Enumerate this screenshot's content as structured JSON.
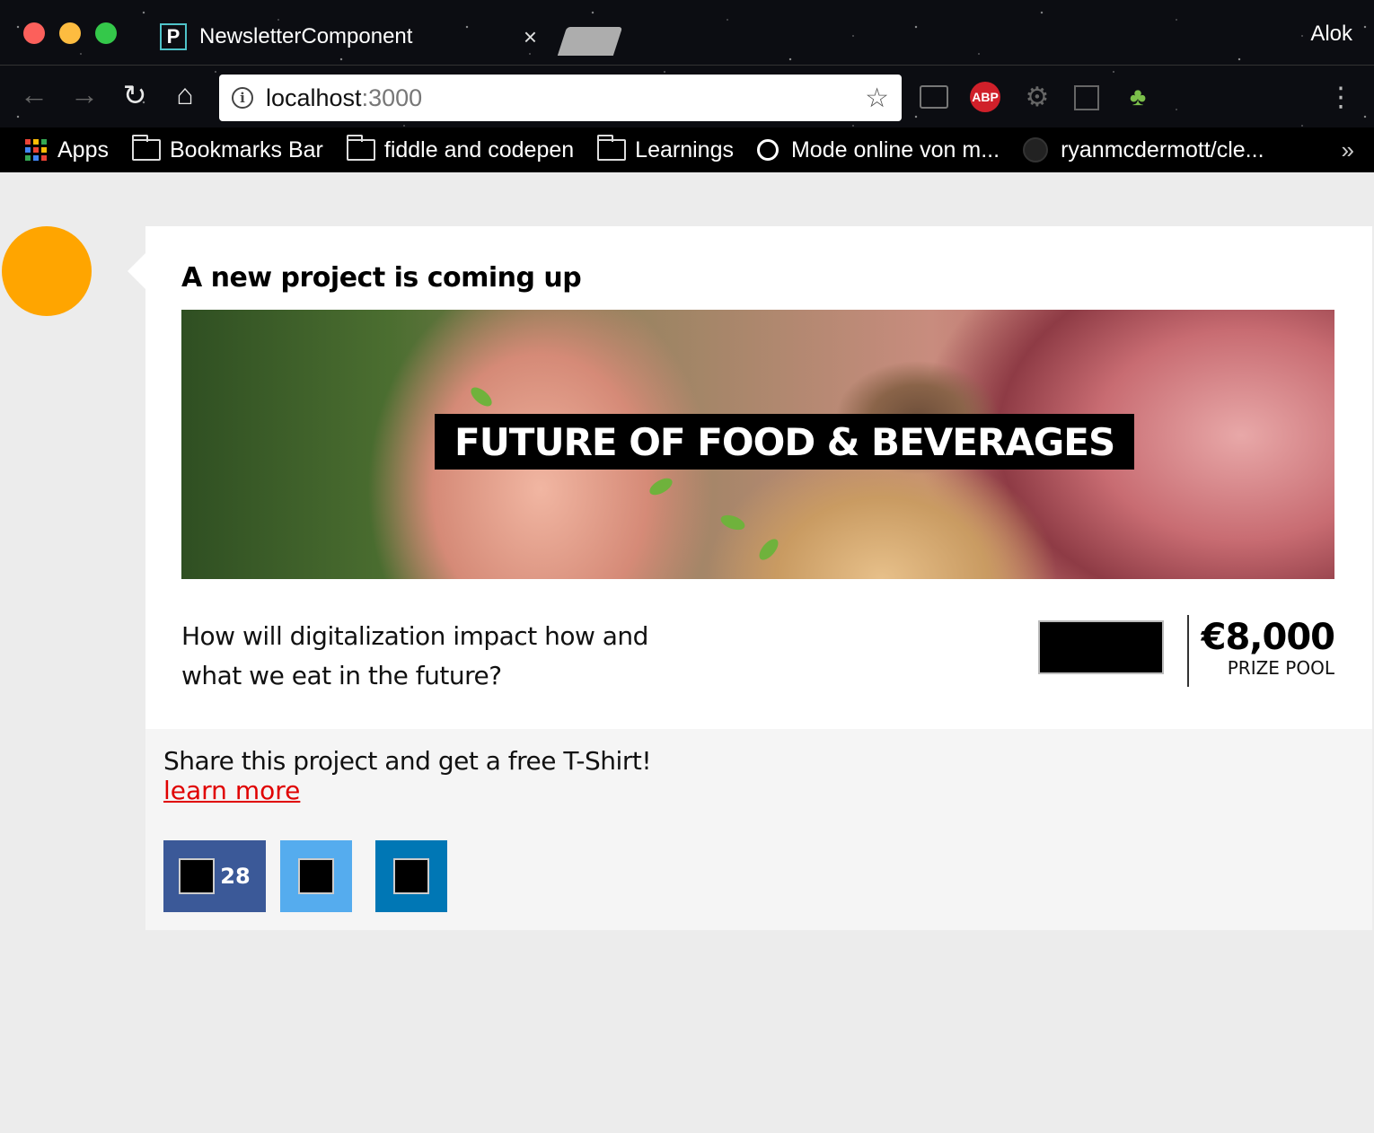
{
  "window": {
    "profile_name": "Alok"
  },
  "tab": {
    "favicon_letter": "P",
    "title": "NewsletterComponent",
    "close_glyph": "×"
  },
  "toolbar": {
    "url_host": "localhost",
    "url_port": ":3000",
    "abp_label": "ABP"
  },
  "bookmarks": {
    "apps_label": "Apps",
    "items": [
      {
        "label": "Bookmarks Bar",
        "icon": "folder-icon"
      },
      {
        "label": "fiddle and codepen",
        "icon": "folder-icon"
      },
      {
        "label": "Learnings",
        "icon": "folder-icon"
      },
      {
        "label": "Mode online von m...",
        "icon": "refresh-favicon"
      },
      {
        "label": "ryanmcdermott/cle...",
        "icon": "github-icon"
      }
    ],
    "more_glyph": "»"
  },
  "card": {
    "heading": "A new project is coming up",
    "hero_title": "FUTURE OF FOOD & BEVERAGES",
    "question": "How will digitalization impact how and what we eat in the future?",
    "prize_amount": "€8,000",
    "prize_label": "PRIZE POOL"
  },
  "share": {
    "text": "Share this project and get a free T-Shirt!",
    "link_label": "learn more",
    "facebook_count": "28"
  },
  "colors": {
    "avatar": "#ffa500",
    "facebook": "#3b5998",
    "twitter": "#55acee",
    "linkedin": "#0077b5",
    "link": "#e00000"
  }
}
